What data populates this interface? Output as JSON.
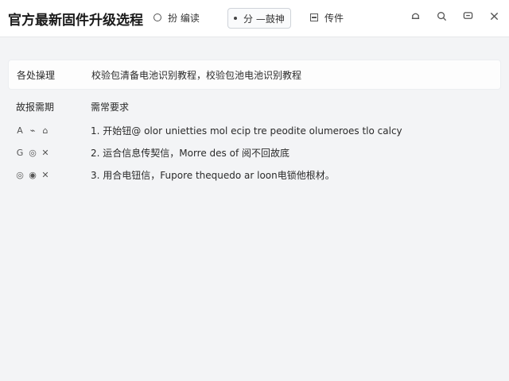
{
  "header": {
    "title": "官方最新固件升级选程",
    "tabs": [
      {
        "label": "扮 编读",
        "icon": "circle-icon"
      },
      {
        "label": "分 —鼓神",
        "icon": "dot-icon"
      },
      {
        "label": "传件",
        "icon": "square-icon"
      }
    ],
    "window_icons": [
      "bell-icon",
      "search-icon",
      "chat-icon",
      "close-icon"
    ]
  },
  "table": {
    "head": {
      "label": "各处操理",
      "text": "校验包清备电池识别教程，校验包池电池识别教程"
    },
    "sub": {
      "label": "故报需期",
      "text": "需常要求"
    },
    "rows": [
      {
        "icons": [
          "A",
          "⌁",
          "⌂"
        ],
        "text": "1. 开始钮@ olor unietties mol ecip tre peodite olumeroes tlo calcy"
      },
      {
        "icons": [
          "G",
          "◎",
          "✕"
        ],
        "text": "2. 运合信息传契信，Morre des of 阅不回故底"
      },
      {
        "icons": [
          "◎",
          "◉",
          "✕"
        ],
        "text": "3. 用合电钮信，Fupore thequedo ar loon电锁他根材。"
      }
    ]
  },
  "colors": {
    "background": "#f3f4f6",
    "bar": "#ffffff",
    "active_tab_border": "#cfd3d9"
  }
}
